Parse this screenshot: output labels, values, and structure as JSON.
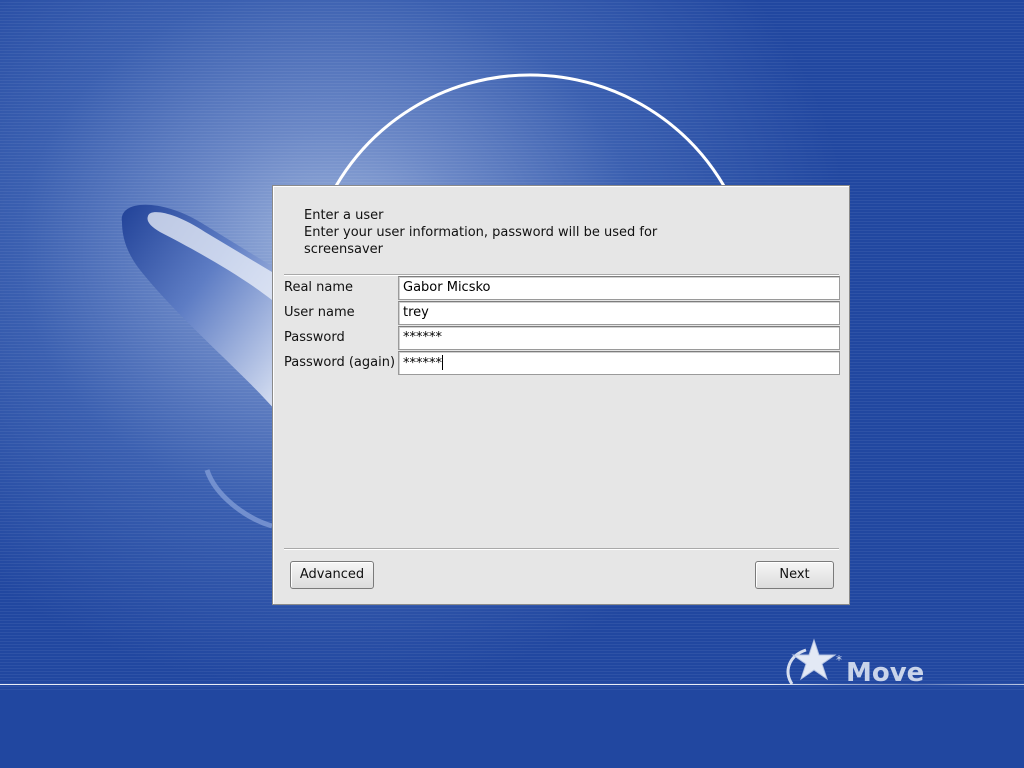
{
  "dialog": {
    "title": "Enter a user",
    "description": "Enter your user information, password will be used for screensaver"
  },
  "form": {
    "fields": [
      {
        "label": "Real name",
        "value": "Gabor Micsko"
      },
      {
        "label": "User name",
        "value": "trey"
      },
      {
        "label": "Password",
        "value": "******"
      },
      {
        "label": "Password (again)",
        "value": "******"
      }
    ]
  },
  "buttons": {
    "advanced_label": "Advanced",
    "next_label": "Next"
  },
  "branding": {
    "logo_text": "Move",
    "logo_icon": "star-swoosh-icon"
  },
  "colors": {
    "desktop_background": "#2147a0",
    "dialog_background": "#e6e6e6"
  }
}
